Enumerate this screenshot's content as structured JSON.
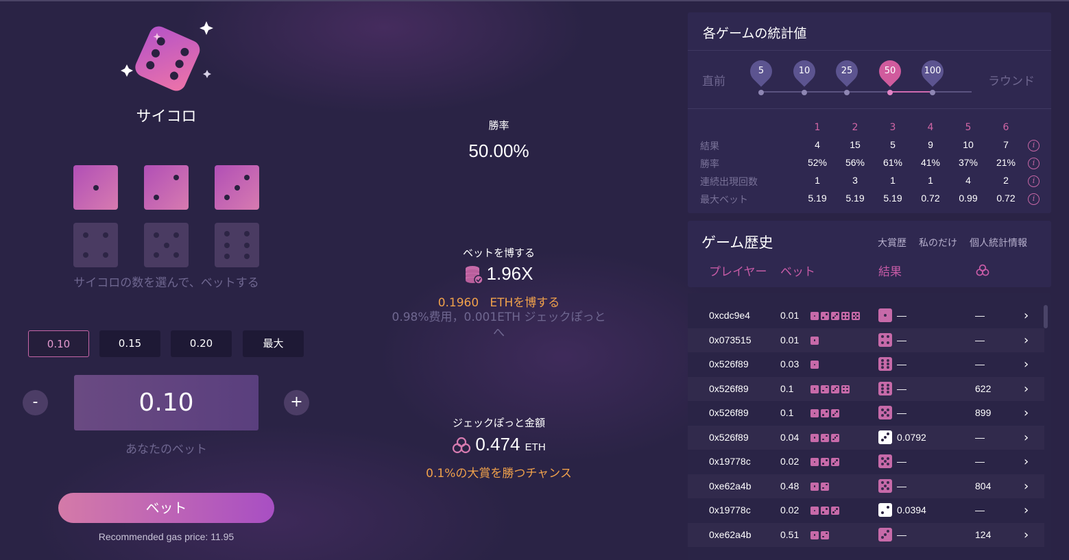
{
  "game": {
    "title": "サイコロ",
    "dice_hint": "サイコロの数を選んで、ベットする",
    "dice": [
      {
        "face": 1,
        "selected": true
      },
      {
        "face": 2,
        "selected": true
      },
      {
        "face": 3,
        "selected": true
      },
      {
        "face": 4,
        "selected": false
      },
      {
        "face": 5,
        "selected": false
      },
      {
        "face": 6,
        "selected": false
      }
    ]
  },
  "bet": {
    "chips": [
      "0.10",
      "0.15",
      "0.20",
      "最大"
    ],
    "active_chip": "0.10",
    "minus": "-",
    "plus": "+",
    "amount": "0.10",
    "caption": "あなたのベット",
    "button": "ベット",
    "gas": "Recommended gas price: 11.95"
  },
  "center": {
    "win_rate_label": "勝率",
    "win_rate": "50.00%",
    "payout_label": "ベットを博する",
    "payout": "1.96X",
    "win_amount": "0.1960",
    "win_unit": "ETHを博する",
    "fee_note": "0.98%费用，0.001ETH ジェックぽっとへ",
    "jackpot_label": "ジェックぽっと金額",
    "jackpot_value": "0.474",
    "jackpot_unit": "ETH",
    "jackpot_chance": "0.1%の大賞を勝つチャンス"
  },
  "stats": {
    "title": "各ゲームの統計値",
    "left_label": "直前",
    "right_label": "ラウンド",
    "rounds": [
      "5",
      "10",
      "25",
      "50",
      "100"
    ],
    "active_round": "50",
    "columns": [
      "1",
      "2",
      "3",
      "4",
      "5",
      "6"
    ],
    "rows": [
      {
        "label": "結果",
        "values": [
          "4",
          "15",
          "5",
          "9",
          "10",
          "7"
        ]
      },
      {
        "label": "勝率",
        "values": [
          "52%",
          "56%",
          "61%",
          "41%",
          "37%",
          "21%"
        ]
      },
      {
        "label": "連続出現回数",
        "values": [
          "1",
          "3",
          "1",
          "1",
          "4",
          "2"
        ]
      },
      {
        "label": "最大ベット",
        "values": [
          "5.19",
          "5.19",
          "5.19",
          "0.72",
          "0.99",
          "0.72"
        ]
      }
    ],
    "info_glyph": "i"
  },
  "history": {
    "title": "ゲーム歴史",
    "tabs": [
      "大賞歴",
      "私のだけ",
      "個人統計情報"
    ],
    "columns": {
      "player": "プレイヤー",
      "bet": "ベット",
      "result": "結果"
    },
    "rows": [
      {
        "player": "0xcdc9e4",
        "bet": "0.01",
        "dice_count": 5,
        "result_face": 1,
        "result_white": false,
        "payout": "—",
        "jackpot": "—"
      },
      {
        "player": "0x073515",
        "bet": "0.01",
        "dice_count": 1,
        "result_face": 4,
        "result_white": false,
        "payout": "—",
        "jackpot": "—"
      },
      {
        "player": "0x526f89",
        "bet": "0.03",
        "dice_count": 1,
        "result_face": 6,
        "result_white": false,
        "payout": "—",
        "jackpot": "—"
      },
      {
        "player": "0x526f89",
        "bet": "0.1",
        "dice_count": 4,
        "result_face": 6,
        "result_white": false,
        "payout": "—",
        "jackpot": "622"
      },
      {
        "player": "0x526f89",
        "bet": "0.1",
        "dice_count": 3,
        "result_face": 5,
        "result_white": false,
        "payout": "—",
        "jackpot": "899"
      },
      {
        "player": "0x526f89",
        "bet": "0.04",
        "dice_count": 3,
        "result_face": 3,
        "result_white": true,
        "payout": "0.0792",
        "jackpot": "—"
      },
      {
        "player": "0x19778c",
        "bet": "0.02",
        "dice_count": 3,
        "result_face": 5,
        "result_white": false,
        "payout": "—",
        "jackpot": "—"
      },
      {
        "player": "0xe62a4b",
        "bet": "0.48",
        "dice_count": 2,
        "result_face": 5,
        "result_white": false,
        "payout": "—",
        "jackpot": "804"
      },
      {
        "player": "0x19778c",
        "bet": "0.02",
        "dice_count": 3,
        "result_face": 2,
        "result_white": true,
        "payout": "0.0394",
        "jackpot": "—"
      },
      {
        "player": "0xe62a4b",
        "bet": "0.51",
        "dice_count": 2,
        "result_face": 3,
        "result_white": false,
        "payout": "—",
        "jackpot": "124"
      }
    ],
    "chevron": "›"
  },
  "colors": {
    "background": "#2a2345",
    "panel": "#2f2850",
    "accent_pink": "#d05b9d",
    "accent_orange": "#f0a14b",
    "muted": "#6f6790"
  },
  "icons": {
    "logo": "dice-logo-icon",
    "payout": "coins-icon",
    "jackpot": "jackpot-clover-icon",
    "info": "info-icon",
    "chevron": "chevron-right-icon"
  }
}
